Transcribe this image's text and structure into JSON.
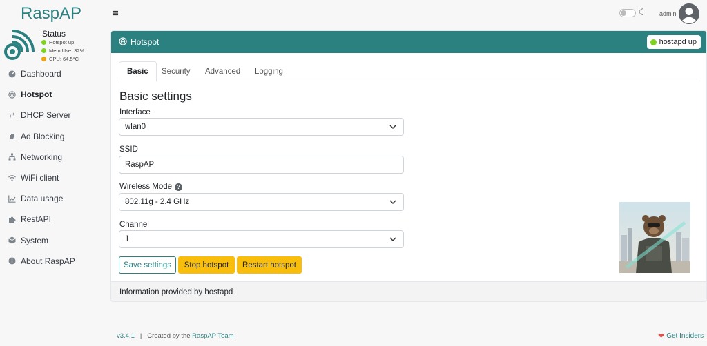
{
  "app": {
    "brand": "RaspAP"
  },
  "status": {
    "title": "Status",
    "items": [
      {
        "text": "Hotspot up",
        "color": "#7ed321"
      },
      {
        "text": "Mem Use: 32%",
        "color": "#7ed321"
      },
      {
        "text": "CPU: 64.5°C",
        "color": "#f0a30a"
      }
    ]
  },
  "sidebar": {
    "items": [
      {
        "label": "Dashboard",
        "icon": "dashboard-icon"
      },
      {
        "label": "Hotspot",
        "icon": "hotspot-icon",
        "active": true
      },
      {
        "label": "DHCP Server",
        "icon": "exchange-icon"
      },
      {
        "label": "Ad Blocking",
        "icon": "hand-icon"
      },
      {
        "label": "Networking",
        "icon": "network-icon"
      },
      {
        "label": "WiFi client",
        "icon": "wifi-icon"
      },
      {
        "label": "Data usage",
        "icon": "chart-icon"
      },
      {
        "label": "RestAPI",
        "icon": "puzzle-icon"
      },
      {
        "label": "System",
        "icon": "cube-icon"
      },
      {
        "label": "About RaspAP",
        "icon": "info-icon"
      }
    ]
  },
  "topbar": {
    "user": "admin"
  },
  "card": {
    "title": "Hotspot",
    "badge": "hostapd up",
    "tabs": [
      "Basic",
      "Security",
      "Advanced",
      "Logging"
    ],
    "section_title": "Basic settings",
    "fields": {
      "interface": {
        "label": "Interface",
        "value": "wlan0"
      },
      "ssid": {
        "label": "SSID",
        "value": "RaspAP"
      },
      "wireless_mode": {
        "label": "Wireless Mode",
        "value": "802.11g - 2.4 GHz"
      },
      "channel": {
        "label": "Channel",
        "value": "1"
      }
    },
    "buttons": {
      "save": "Save settings",
      "stop": "Stop hotspot",
      "restart": "Restart hotspot"
    },
    "footer": "Information provided by hostapd"
  },
  "footer": {
    "version": "v3.4.1",
    "separator": "|",
    "created_by": "Created by the",
    "team_link": "RaspAP Team",
    "insiders": "Get Insiders"
  },
  "colors": {
    "brand": "#2b8080",
    "warning": "#f9be0b",
    "status_ok": "#7ed321",
    "status_warn": "#f0a30a"
  }
}
